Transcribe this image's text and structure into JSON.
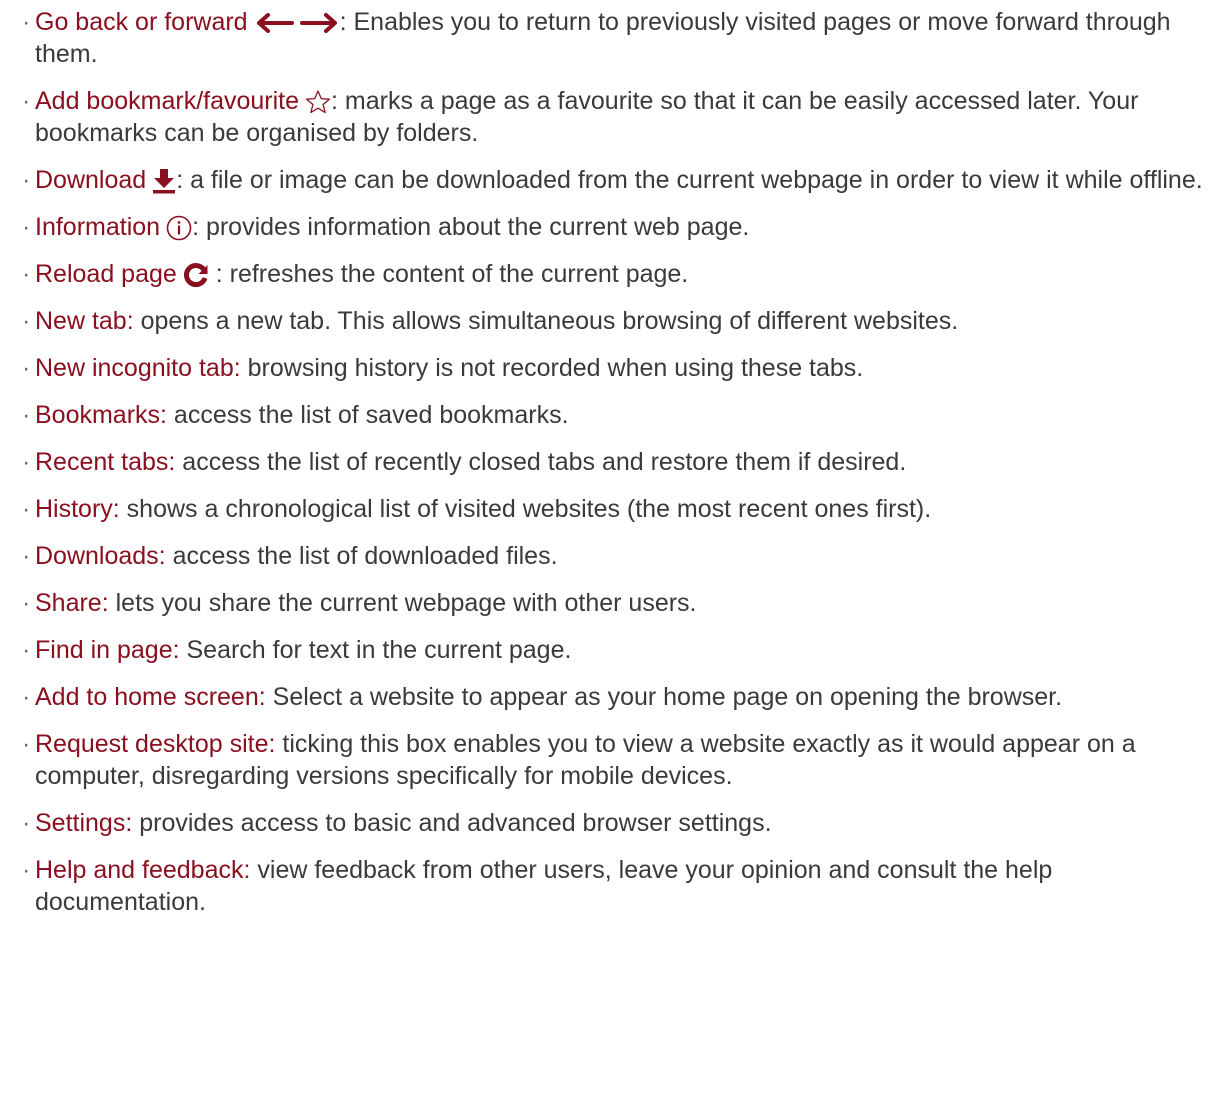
{
  "accent_color": "#8a1020",
  "text_color": "#3a3a3a",
  "bullet": "·",
  "items": [
    {
      "term": "Go back or forward",
      "icons": [
        "arrow-left-icon",
        "arrow-right-icon"
      ],
      "desc": ": Enables you to return to previously visited pages or move forward through them."
    },
    {
      "term": "Add bookmark/favourite",
      "icons": [
        "star-outline-icon"
      ],
      "desc": ": marks a page as a favourite so that it can be easily accessed later. Your bookmarks can be organised by folders."
    },
    {
      "term": "Download",
      "icons": [
        "download-icon"
      ],
      "desc": ": a file or image can be downloaded from the current webpage in order to view it while offline."
    },
    {
      "term": "Information",
      "icons": [
        "info-circle-icon"
      ],
      "desc": ": provides information about the current web page."
    },
    {
      "term": "Reload page",
      "icons": [
        "reload-icon"
      ],
      "desc": " : refreshes the content of the current page."
    },
    {
      "term": "New tab:",
      "icons": [],
      "desc": " opens a new tab. This allows simultaneous browsing of different websites."
    },
    {
      "term": "New incognito tab:",
      "icons": [],
      "desc": " browsing history is not recorded when using these tabs."
    },
    {
      "term": "Bookmarks:",
      "icons": [],
      "desc": " access the list of saved bookmarks."
    },
    {
      "term": "Recent tabs:",
      "icons": [],
      "desc": " access the list of recently closed tabs and restore them if desired."
    },
    {
      "term": "History:",
      "icons": [],
      "desc": " shows a chronological list of visited websites (the most recent ones first)."
    },
    {
      "term": "Downloads:",
      "icons": [],
      "desc": " access the list of downloaded files."
    },
    {
      "term": "Share:",
      "icons": [],
      "desc": " lets you share the current webpage with other users."
    },
    {
      "term": "Find in page:",
      "icons": [],
      "desc": " Search for text in the current page."
    },
    {
      "term": "Add to home screen:",
      "icons": [],
      "desc": " Select a website to appear as your home page on opening the browser."
    },
    {
      "term": "Request desktop site:",
      "icons": [],
      "desc": " ticking this box enables you to view a website exactly as it would appear on a computer, disregarding versions specifically for mobile devices."
    },
    {
      "term": "Settings:",
      "icons": [],
      "desc": " provides access to basic and advanced browser settings."
    },
    {
      "term": "Help and feedback:",
      "icons": [],
      "desc": " view feedback from other users, leave your opinion and consult the help documentation."
    }
  ]
}
